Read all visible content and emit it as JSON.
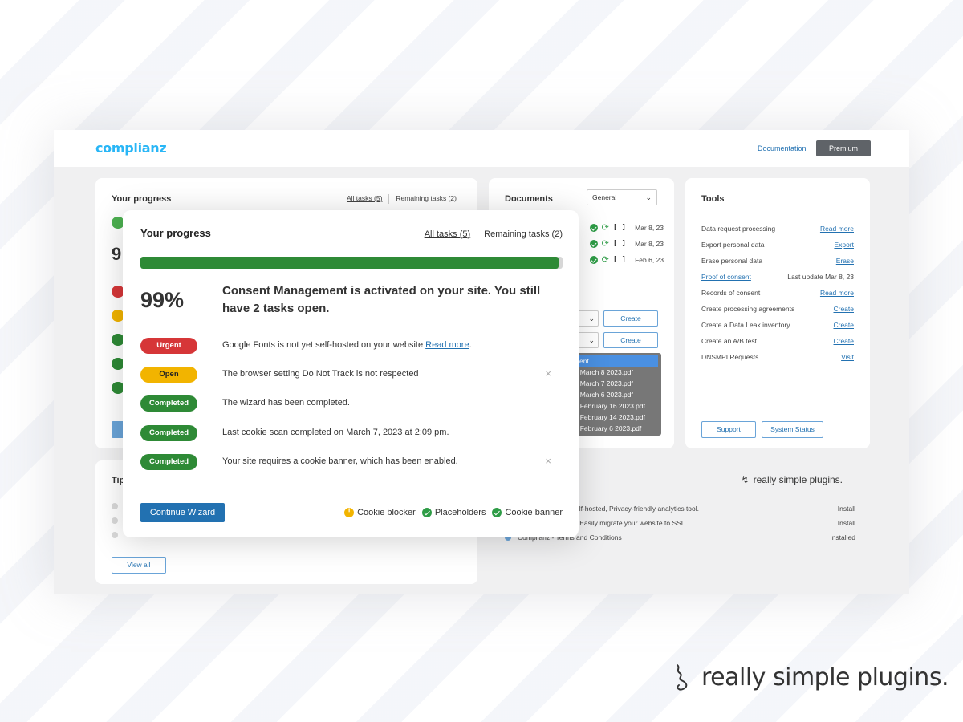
{
  "app": {
    "logo": "complianz",
    "documentation_link": "Documentation",
    "premium_button": "Premium"
  },
  "progress_card": {
    "title": "Your progress",
    "tab_all": "All tasks (5)",
    "tab_remaining": "Remaining tasks (2)"
  },
  "documents_card": {
    "title": "Documents",
    "select_value": "General",
    "rows": [
      {
        "date": "Mar 8, 23"
      },
      {
        "date": "Mar 8, 23"
      },
      {
        "date": "Feb 6, 23"
      }
    ],
    "create_label": "Create",
    "dropdown_items": [
      "ent",
      "t March 8 2023.pdf",
      "t March 7 2023.pdf",
      "t March 6 2023.pdf",
      "t February 16 2023.pdf",
      "t February 14 2023.pdf",
      "t February 6 2023.pdf"
    ]
  },
  "tools_card": {
    "title": "Tools",
    "rows": [
      {
        "label": "Data request processing",
        "action": "Read more"
      },
      {
        "label": "Export personal data",
        "action": "Export"
      },
      {
        "label": "Erase personal data",
        "action": "Erase"
      },
      {
        "label": "Proof of consent",
        "action": "Last update Mar 8, 23"
      },
      {
        "label": "Records of consent",
        "action": "Read more"
      },
      {
        "label": "Create processing agreements",
        "action": "Create"
      },
      {
        "label": "Create a Data Leak inventory",
        "action": "Create"
      },
      {
        "label": "Create an A/B test",
        "action": "Create"
      },
      {
        "label": "DNSMPI Requests",
        "action": "Visit"
      }
    ],
    "support_button": "Support",
    "system_status_button": "System Status"
  },
  "tips_card": {
    "title": "Tip",
    "view_all": "View all"
  },
  "rsp_card": {
    "brand": "really simple plugins.",
    "rows": [
      {
        "label": "elf-hosted, Privacy-friendly analytics tool.",
        "status": "Install"
      },
      {
        "label": "- Easily migrate your website to SSL",
        "status": "Install"
      },
      {
        "label": "Complianz - Terms and Conditions",
        "status": "Installed"
      }
    ]
  },
  "modal": {
    "title": "Your progress",
    "tab_all": "All tasks (5)",
    "tab_remaining": "Remaining tasks (2)",
    "progress_percent": 99,
    "percent_text": "99%",
    "message": "Consent Management is activated on your site. You still have 2 tasks open.",
    "tasks": [
      {
        "status": "Urgent",
        "text": "Google Fonts is not yet self-hosted on your website ",
        "link": "Read more",
        "suffix": ".",
        "dismissable": false
      },
      {
        "status": "Open",
        "text": "The browser setting Do Not Track is not respected",
        "dismissable": true
      },
      {
        "status": "Completed",
        "text": "The wizard has been completed.",
        "dismissable": false
      },
      {
        "status": "Completed",
        "text": "Last cookie scan completed on March 7, 2023 at 2:09 pm.",
        "dismissable": false
      },
      {
        "status": "Completed",
        "text": "Your site requires a cookie banner, which has been enabled.",
        "dismissable": true
      }
    ],
    "continue_button": "Continue Wizard",
    "footer": {
      "cookie_blocker": "Cookie blocker",
      "placeholders": "Placeholders",
      "cookie_banner": "Cookie banner"
    }
  },
  "colors": {
    "urgent": "#d63638",
    "open": "#f2b400",
    "completed": "#2e8a36",
    "primary": "#2271b1",
    "logo": "#29b6f6"
  },
  "footer_brand": "really simple plugins."
}
